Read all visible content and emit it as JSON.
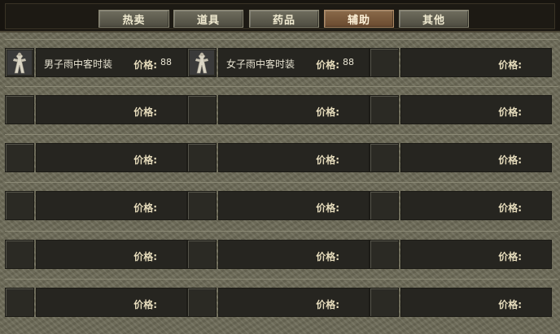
{
  "tabs": [
    {
      "label": "热卖",
      "active": false
    },
    {
      "label": "道具",
      "active": false
    },
    {
      "label": "药品",
      "active": false
    },
    {
      "label": "辅助",
      "active": true
    },
    {
      "label": "其他",
      "active": false
    }
  ],
  "price_label": "价格:",
  "rows": [
    [
      {
        "name": "男子雨中客时装",
        "price": "88",
        "icon": "robe-figure-icon"
      },
      {
        "name": "女子雨中客时装",
        "price": "88",
        "icon": "robe-figure-icon"
      },
      {
        "name": "",
        "price": "",
        "icon": ""
      }
    ],
    [
      {
        "name": "",
        "price": "",
        "icon": ""
      },
      {
        "name": "",
        "price": "",
        "icon": ""
      },
      {
        "name": "",
        "price": "",
        "icon": ""
      }
    ],
    [
      {
        "name": "",
        "price": "",
        "icon": ""
      },
      {
        "name": "",
        "price": "",
        "icon": ""
      },
      {
        "name": "",
        "price": "",
        "icon": ""
      }
    ],
    [
      {
        "name": "",
        "price": "",
        "icon": ""
      },
      {
        "name": "",
        "price": "",
        "icon": ""
      },
      {
        "name": "",
        "price": "",
        "icon": ""
      }
    ],
    [
      {
        "name": "",
        "price": "",
        "icon": ""
      },
      {
        "name": "",
        "price": "",
        "icon": ""
      },
      {
        "name": "",
        "price": "",
        "icon": ""
      }
    ],
    [
      {
        "name": "",
        "price": "",
        "icon": ""
      },
      {
        "name": "",
        "price": "",
        "icon": ""
      },
      {
        "name": "",
        "price": "",
        "icon": ""
      }
    ]
  ],
  "colors": {
    "active_tab": "#7a5a3c",
    "tab": "#5f5d50",
    "background": "#6d6b58"
  }
}
